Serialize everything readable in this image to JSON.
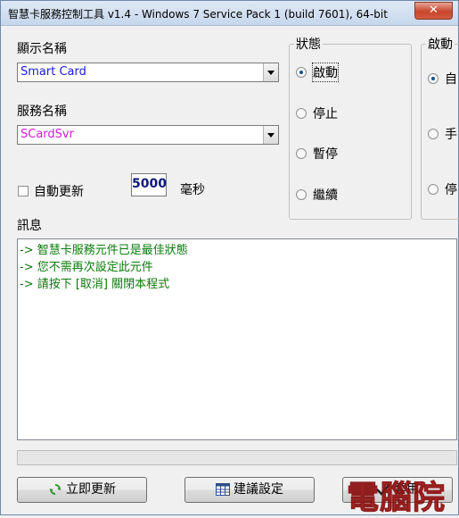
{
  "window": {
    "title": "智慧卡服務控制工具 v1.4 - Windows 7  Service Pack 1 (build 7601), 64-bit",
    "close_symbol": "✕"
  },
  "display_name": {
    "label": "顯示名稱",
    "value": "Smart Card",
    "value_color": "#1a1adc"
  },
  "service_name": {
    "label": "服務名稱",
    "value": "SCardSvr",
    "value_color": "#d61ad6"
  },
  "auto_refresh": {
    "label": "自動更新",
    "checked": false,
    "interval": "5000",
    "unit": "毫秒"
  },
  "status_group": {
    "title": "狀態",
    "options": [
      {
        "label": "啟動",
        "selected": true
      },
      {
        "label": "停止",
        "selected": false
      },
      {
        "label": "暫停",
        "selected": false
      },
      {
        "label": "繼續",
        "selected": false
      }
    ]
  },
  "startup_group": {
    "title": "啟動",
    "options": [
      {
        "label": "自",
        "selected": true
      },
      {
        "label": "手",
        "selected": false
      },
      {
        "label": "停",
        "selected": false
      }
    ]
  },
  "messages": {
    "label": "訊息",
    "lines": [
      "-> 智慧卡服務元件已是最佳狀態",
      "-> 您不需再次設定此元件",
      "-> 請按下 [取消] 關閉本程式"
    ],
    "color": "#0a7a0a"
  },
  "buttons": {
    "refresh": "立即更新",
    "recommend": "建議設定",
    "apply": "套用"
  },
  "watermark": "電腦院"
}
